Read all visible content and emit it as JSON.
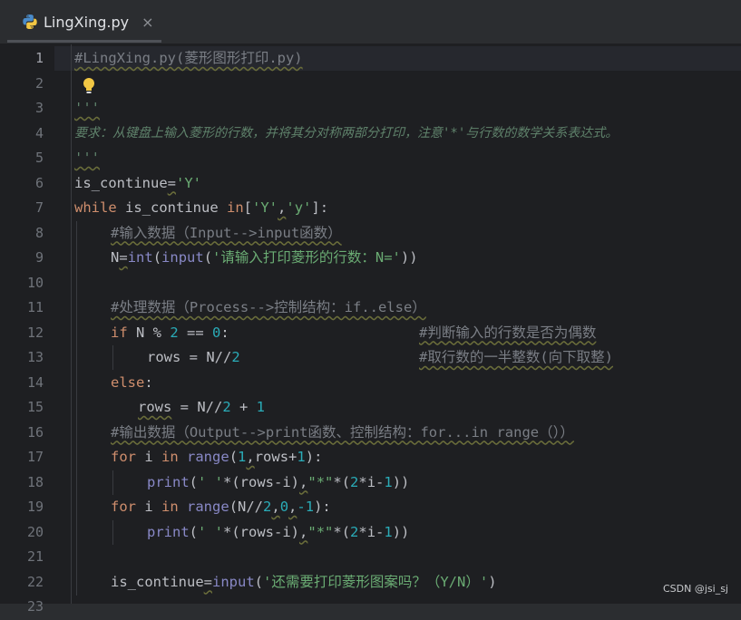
{
  "tab": {
    "title": "LingXing.py",
    "close_glyph": "×",
    "icon": "python-icon"
  },
  "line_numbers": [
    "1",
    "2",
    "3",
    "4",
    "5",
    "6",
    "7",
    "8",
    "9",
    "10",
    "11",
    "12",
    "13",
    "14",
    "15",
    "16",
    "17",
    "18",
    "19",
    "20",
    "21",
    "22",
    "23"
  ],
  "code": {
    "l1": "#LingXing.py(菱形图形打印.py)",
    "l3": "'''",
    "l4": "要求：从键盘上输入菱形的行数，并将其分对称两部分打印，注意'*'与行数的数学关系表达式。",
    "l5": "'''",
    "l6_a": "is_continue",
    "l6_b": "=",
    "l6_c": "'Y'",
    "l7_kw": "while",
    "l7_a": " is_continue ",
    "l7_kw2": "in",
    "l7_b": "[",
    "l7_s1": "'Y'",
    "l7_c": ",",
    "l7_s2": "'y'",
    "l7_d": "]:",
    "l8": "#输入数据（Input-->input函数）",
    "l9_a": "N",
    "l9_b": "=",
    "l9_bi1": "int",
    "l9_c": "(",
    "l9_bi2": "input",
    "l9_d": "(",
    "l9_s": "'请输入打印菱形的行数：N='",
    "l9_e": "))",
    "l11": "#处理数据（Process-->控制结构：if..else）",
    "l12_kw": "if",
    "l12_a": " N % ",
    "l12_n1": "2",
    "l12_b": " == ",
    "l12_n2": "0",
    "l12_c": ":",
    "l12_cmt": "#判断输入的行数是否为偶数",
    "l13_a": "rows = N//",
    "l13_n": "2",
    "l13_cmt": "#取行数的一半整数(向下取整)",
    "l14_kw": "else",
    "l14_a": ":",
    "l15_a": "rows",
    "l15_b": " = N//",
    "l15_n1": "2",
    "l15_c": " + ",
    "l15_n2": "1",
    "l16": "#输出数据（Output-->print函数、控制结构：for...in range（））",
    "l17_kw": "for",
    "l17_a": " i ",
    "l17_kw2": "in",
    "l17_sp": " ",
    "l17_bi": "range",
    "l17_b": "(",
    "l17_n1": "1",
    "l17_c": ",",
    "l17_d": "rows+",
    "l17_n2": "1",
    "l17_e": "):",
    "l18_bi": "print",
    "l18_a": "(",
    "l18_s1": "' '",
    "l18_b": "*(rows-i)",
    "l18_c": ",",
    "l18_s2": "\"*\"",
    "l18_d": "*(",
    "l18_n1": "2",
    "l18_e": "*i-",
    "l18_n2": "1",
    "l18_f": "))",
    "l19_kw": "for",
    "l19_a": " i ",
    "l19_kw2": "in",
    "l19_sp": " ",
    "l19_bi": "range",
    "l19_b": "(N//",
    "l19_n1": "2",
    "l19_c": ",",
    "l19_n2": "0",
    "l19_d": ",",
    "l19_n3": "-1",
    "l19_e": "):",
    "l20_bi": "print",
    "l20_a": "(",
    "l20_s1": "' '",
    "l20_b": "*(rows-i)",
    "l20_c": ",",
    "l20_s2": "\"*\"",
    "l20_d": "*(",
    "l20_n1": "2",
    "l20_e": "*i-",
    "l20_n2": "1",
    "l20_f": "))",
    "l22_a": "is_continue",
    "l22_b": "=",
    "l22_bi": "input",
    "l22_c": "(",
    "l22_s": "'还需要打印菱形图案吗？（Y/N）'",
    "l22_d": ")"
  },
  "watermark": "CSDN @jsi_sj",
  "colors": {
    "background": "#1e1f22",
    "keyword": "#cf8e6d",
    "string": "#6aab73",
    "number": "#2aacb8",
    "comment": "#7a7e85",
    "docstring": "#5f826b",
    "builtin": "#8888c6"
  }
}
